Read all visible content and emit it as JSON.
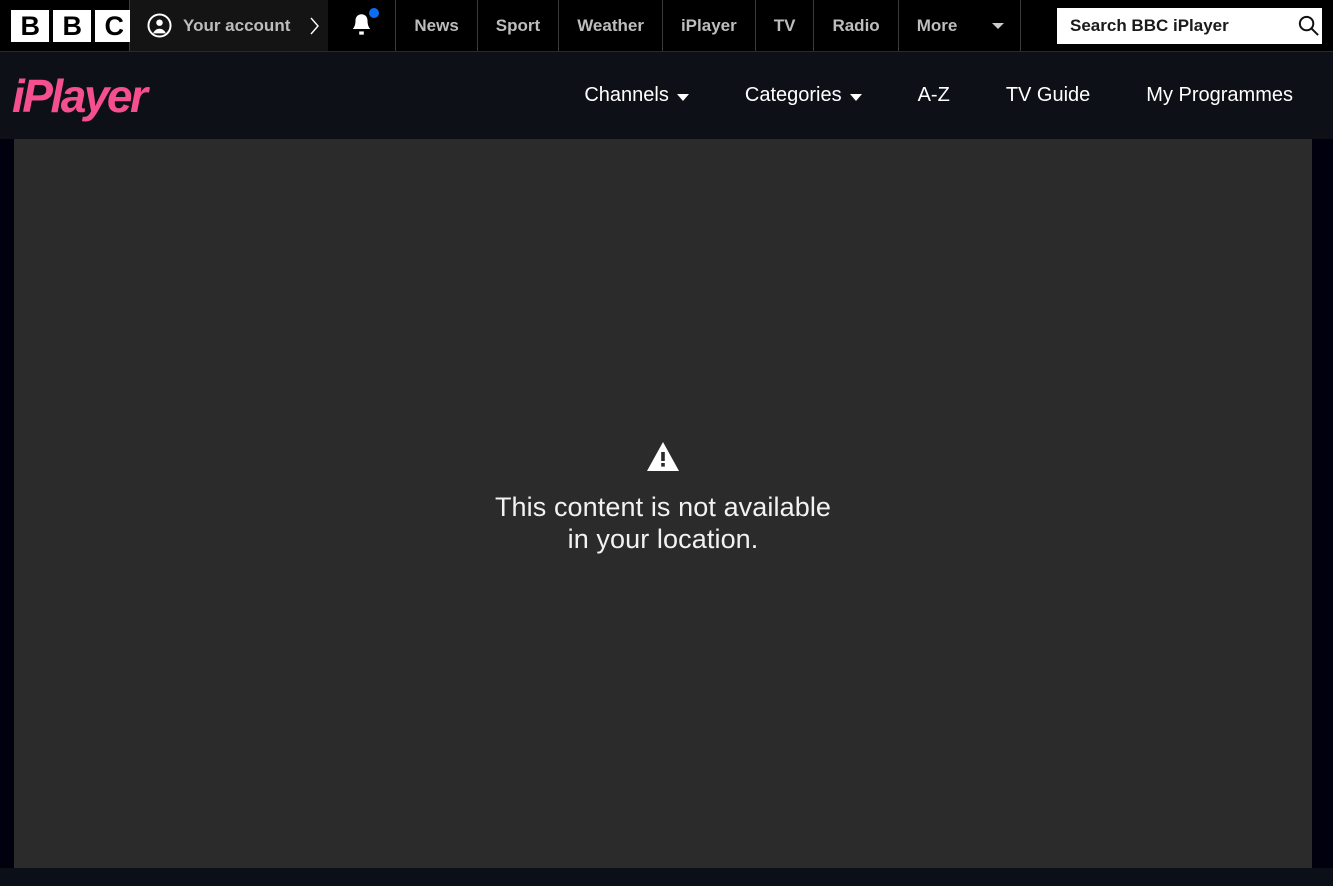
{
  "global_nav": {
    "logo_letters": [
      "B",
      "B",
      "C"
    ],
    "account_label": "Your account",
    "account_icon": "account-circle-icon",
    "notifications_icon": "bell-icon",
    "notifications_badge": true,
    "items": [
      {
        "label": "News"
      },
      {
        "label": "Sport"
      },
      {
        "label": "Weather"
      },
      {
        "label": "iPlayer"
      },
      {
        "label": "TV"
      },
      {
        "label": "Radio"
      },
      {
        "label": "More"
      }
    ],
    "more_caret_icon": "chevron-down-icon",
    "search": {
      "value": "",
      "placeholder": "Search BBC iPlayer",
      "icon": "search-icon"
    }
  },
  "iplayer_nav": {
    "brand": "iPlayer",
    "brand_color": "#f54f8f",
    "items": [
      {
        "label": "Channels",
        "has_caret": true
      },
      {
        "label": "Categories",
        "has_caret": true
      },
      {
        "label": "A-Z",
        "has_caret": false
      },
      {
        "label": "TV Guide",
        "has_caret": false
      },
      {
        "label": "My Programmes",
        "has_caret": false
      }
    ]
  },
  "player": {
    "state": "error",
    "error_icon": "warning-triangle-icon",
    "error_message": "This content is not available in your location.",
    "background_color": "#2b2b2b"
  },
  "theme": {
    "top_bar_background": "#000000",
    "iplayer_bar_background": "#0d1017",
    "page_background": "#0b0f17",
    "accent_pink": "#f54f8f",
    "badge_blue": "#0d6cf2"
  }
}
